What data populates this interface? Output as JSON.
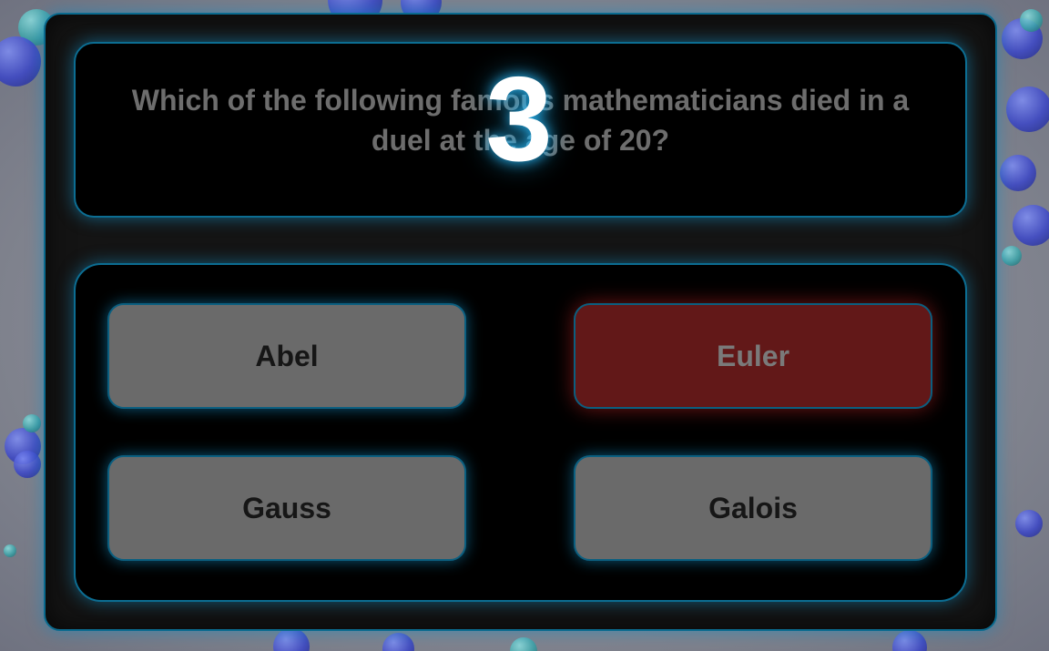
{
  "question": {
    "text": "Which of the following famous mathematicians died in a duel at the age of 20?"
  },
  "countdown": {
    "value": "3"
  },
  "answers": [
    {
      "label": "Abel",
      "state": "default"
    },
    {
      "label": "Euler",
      "state": "wrong"
    },
    {
      "label": "Gauss",
      "state": "default"
    },
    {
      "label": "Galois",
      "state": "default"
    }
  ],
  "colors": {
    "panel_border": "#0a6a8e",
    "glow": "#28beff",
    "answer_bg": "#6a6a6a",
    "wrong_bg": "#621818",
    "question_text": "#6d6d6d"
  }
}
